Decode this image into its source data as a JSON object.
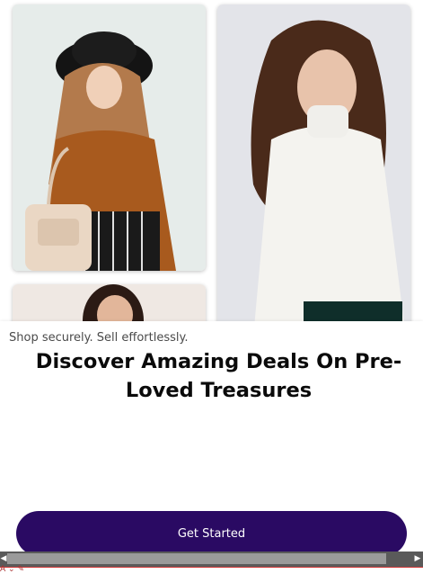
{
  "gallery": {
    "photos": [
      {
        "subject": "woman in hijab and black hat with tote bag"
      },
      {
        "subject": "woman with curly hair in white turtleneck"
      },
      {
        "subject": "woman portrait (partially visible)"
      }
    ]
  },
  "onboarding": {
    "tagline": "Shop securely. Sell effortlessly.",
    "headline": "Discover Amazing Deals On Pre-Loved Treasures",
    "cta_label": "Get Started"
  },
  "scrollbar": {
    "left_arrow": "◀",
    "right_arrow": "▶"
  },
  "bottom_strip": {
    "label": "A ⌄  ✎"
  },
  "colors": {
    "accent": "#2a0a63",
    "background": "#ffffff",
    "text_primary": "#0a0a0a",
    "text_secondary": "#4a4a4a"
  }
}
